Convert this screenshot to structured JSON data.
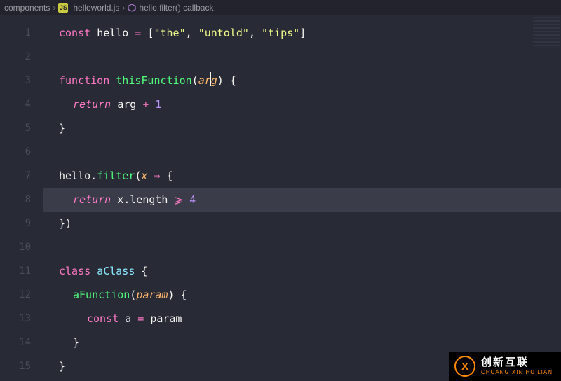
{
  "breadcrumb": {
    "folder": "components",
    "file": "helloworld.js",
    "symbol": "hello.filter() callback"
  },
  "icons": {
    "symbol_glyph": "⬢"
  },
  "editor": {
    "highlighted_line": 8,
    "line_numbers": [
      "1",
      "2",
      "3",
      "4",
      "5",
      "6",
      "7",
      "8",
      "9",
      "10",
      "11",
      "12",
      "13",
      "14",
      "15"
    ],
    "lines": [
      {
        "tokens": [
          {
            "t": "const ",
            "c": "kw"
          },
          {
            "t": "hello ",
            "c": "name"
          },
          {
            "t": "= ",
            "c": "op"
          },
          {
            "t": "[",
            "c": "pun"
          },
          {
            "t": "\"the\"",
            "c": "str"
          },
          {
            "t": ", ",
            "c": "pun"
          },
          {
            "t": "\"untold\"",
            "c": "str"
          },
          {
            "t": ", ",
            "c": "pun"
          },
          {
            "t": "\"tips\"",
            "c": "str"
          },
          {
            "t": "]",
            "c": "pun"
          }
        ]
      },
      {
        "tokens": []
      },
      {
        "tokens": [
          {
            "t": "function ",
            "c": "kw"
          },
          {
            "t": "thisFunction",
            "c": "fn"
          },
          {
            "t": "(",
            "c": "pun"
          },
          {
            "t": "ar",
            "c": "param"
          },
          {
            "t": "",
            "c": "cursor"
          },
          {
            "t": "g",
            "c": "param"
          },
          {
            "t": ") ",
            "c": "pun"
          },
          {
            "t": "{",
            "c": "pun"
          }
        ]
      },
      {
        "indent": 1,
        "tokens": [
          {
            "t": "return ",
            "c": "kwret"
          },
          {
            "t": "arg ",
            "c": "name"
          },
          {
            "t": "+ ",
            "c": "op"
          },
          {
            "t": "1",
            "c": "num"
          }
        ]
      },
      {
        "tokens": [
          {
            "t": "}",
            "c": "pun"
          }
        ]
      },
      {
        "tokens": []
      },
      {
        "tokens": [
          {
            "t": "hello",
            "c": "name"
          },
          {
            "t": ".",
            "c": "pun"
          },
          {
            "t": "filter",
            "c": "fn"
          },
          {
            "t": "(",
            "c": "pun"
          },
          {
            "t": "x ",
            "c": "param"
          },
          {
            "t": "⇒ ",
            "c": "op"
          },
          {
            "t": "{",
            "c": "pun"
          }
        ]
      },
      {
        "indent": 1,
        "hl": true,
        "tokens": [
          {
            "t": "return ",
            "c": "kwret"
          },
          {
            "t": "x",
            "c": "name"
          },
          {
            "t": ".",
            "c": "pun"
          },
          {
            "t": "length ",
            "c": "name"
          },
          {
            "t": "⩾ ",
            "c": "op"
          },
          {
            "t": "4",
            "c": "num"
          }
        ]
      },
      {
        "tokens": [
          {
            "t": "})",
            "c": "pun"
          }
        ]
      },
      {
        "tokens": []
      },
      {
        "tokens": [
          {
            "t": "class ",
            "c": "kw"
          },
          {
            "t": "aClass ",
            "c": "cls"
          },
          {
            "t": "{",
            "c": "pun"
          }
        ]
      },
      {
        "indent": 1,
        "tokens": [
          {
            "t": "aFunction",
            "c": "fn"
          },
          {
            "t": "(",
            "c": "pun"
          },
          {
            "t": "param",
            "c": "param"
          },
          {
            "t": ") ",
            "c": "pun"
          },
          {
            "t": "{",
            "c": "pun"
          }
        ]
      },
      {
        "indent": 2,
        "tokens": [
          {
            "t": "const ",
            "c": "kw"
          },
          {
            "t": "a ",
            "c": "name"
          },
          {
            "t": "= ",
            "c": "op"
          },
          {
            "t": "param",
            "c": "name"
          }
        ]
      },
      {
        "indent": 1,
        "tokens": [
          {
            "t": "}",
            "c": "pun"
          }
        ]
      },
      {
        "tokens": [
          {
            "t": "}",
            "c": "pun"
          }
        ]
      }
    ]
  },
  "watermark": {
    "logo_letter": "X",
    "line1": "创新互联",
    "line2": "CHUANG XIN HU LIAN"
  }
}
